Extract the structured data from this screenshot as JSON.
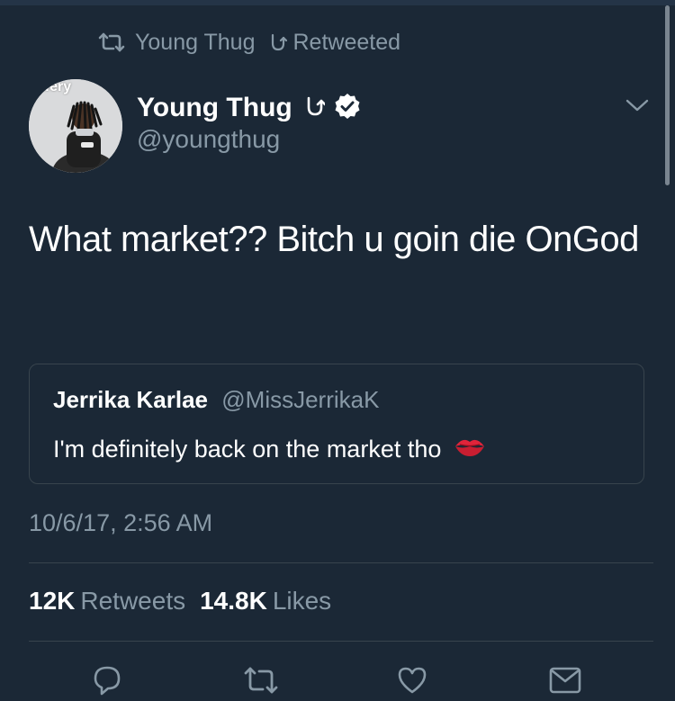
{
  "retweet_context": {
    "icon": "retweet-icon",
    "user": "Young Thug",
    "symbol_icon": "omega-symbol-icon",
    "label": "Retweeted"
  },
  "author": {
    "avatar_watermark": "iffery",
    "name": "Young Thug",
    "symbol_icon": "omega-symbol-icon",
    "verified_icon": "verified-badge-icon",
    "handle": "@youngthug"
  },
  "tweet": {
    "text": "What market?? Bitch u goin die OnGod"
  },
  "quoted_tweet": {
    "name": "Jerrika Karlae",
    "handle": "@MissJerrikaK",
    "text": "I'm definitely back on the market tho",
    "emoji_icon": "kiss-mark-icon"
  },
  "meta": {
    "timestamp": "10/6/17, 2:56 AM"
  },
  "stats": {
    "retweets_count": "12K",
    "retweets_label": "Retweets",
    "likes_count": "14.8K",
    "likes_label": "Likes"
  },
  "actions": [
    "reply-icon",
    "retweet-icon",
    "like-icon",
    "share-icon"
  ],
  "colors": {
    "background": "#1b2836",
    "text_primary": "#ffffff",
    "text_secondary": "#8899a6",
    "border": "#38444d"
  }
}
